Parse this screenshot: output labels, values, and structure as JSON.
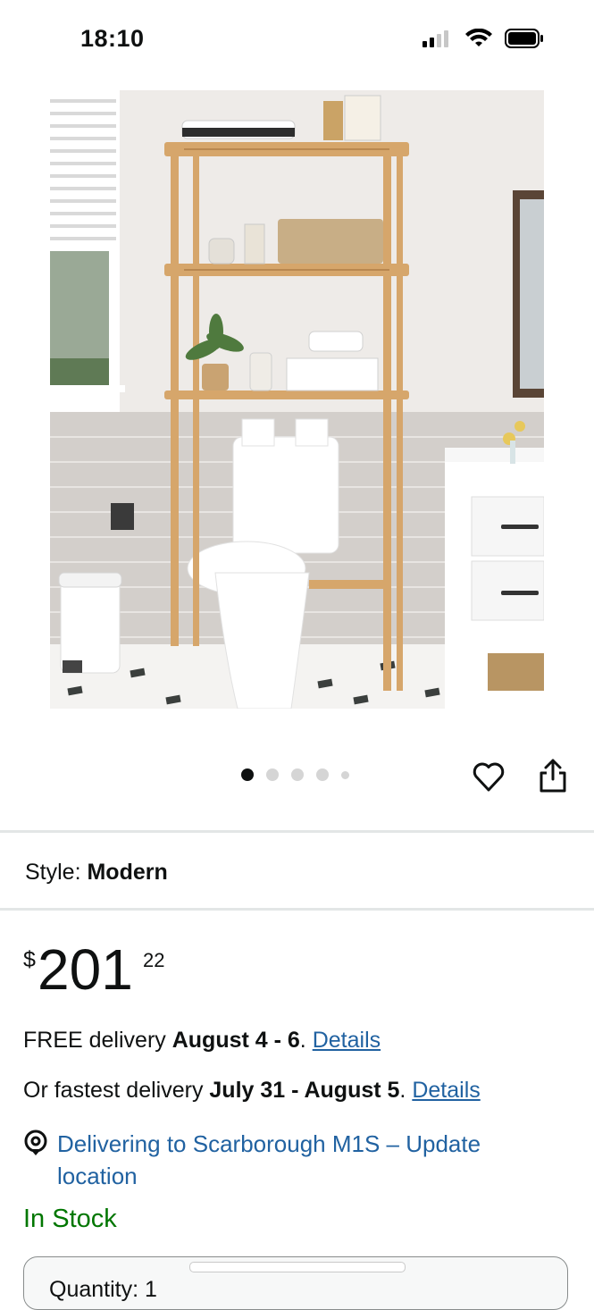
{
  "status_bar": {
    "time": "18:10"
  },
  "product": {
    "carousel": {
      "count": 5,
      "active_index": 0
    }
  },
  "style": {
    "label": "Style:",
    "value": "Modern"
  },
  "price": {
    "symbol": "$",
    "whole": "201",
    "fraction": "22"
  },
  "delivery": {
    "free_prefix": "FREE delivery",
    "free_dates": "August 4 - 6",
    "free_period": ".",
    "details_label": "Details",
    "fastest_prefix": "Or fastest delivery",
    "fastest_dates": "July 31 - August 5",
    "fastest_period": ".",
    "fastest_details_label": "Details"
  },
  "location": {
    "text": "Delivering to Scarborough M1S – Update location"
  },
  "stock": {
    "text": "In Stock",
    "color": "#007600"
  },
  "quantity": {
    "text": "Quantity: 1"
  },
  "colors": {
    "link": "#2162a1",
    "text": "#0f1111"
  }
}
